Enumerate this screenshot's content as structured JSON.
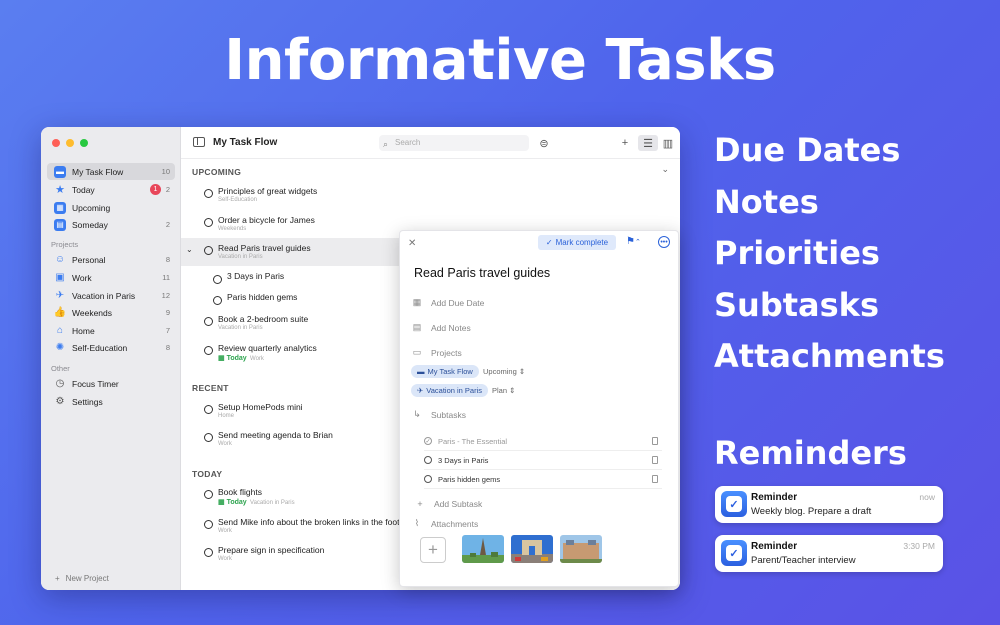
{
  "headline": "Informative Tasks",
  "features": [
    "Due Dates",
    "Notes",
    "Priorities",
    "Subtasks",
    "Attachments"
  ],
  "reminders": {
    "title": "Reminders",
    "items": [
      {
        "title": "Reminder",
        "body": "Weekly blog. Prepare a draft",
        "time": "now"
      },
      {
        "title": "Reminder",
        "body": "Parent/Teacher interview",
        "time": "3:30 PM"
      }
    ]
  },
  "sidebar": {
    "items": [
      {
        "label": "My Task Flow",
        "count": "10",
        "icon": "tray-icon",
        "color": "#3b7cf0"
      },
      {
        "label": "Today",
        "count": "2",
        "badge": "1",
        "icon": "star-icon",
        "color": "#3b7cf0"
      },
      {
        "label": "Upcoming",
        "count": "",
        "icon": "calendar-icon",
        "color": "#3b7cf0"
      },
      {
        "label": "Someday",
        "count": "2",
        "icon": "archive-icon",
        "color": "#3b7cf0"
      }
    ],
    "projects_label": "Projects",
    "projects": [
      {
        "label": "Personal",
        "count": "8",
        "icon": "person-icon"
      },
      {
        "label": "Work",
        "count": "11",
        "icon": "briefcase-icon"
      },
      {
        "label": "Vacation in Paris",
        "count": "12",
        "icon": "airplane-icon"
      },
      {
        "label": "Weekends",
        "count": "9",
        "icon": "thumbs-up-icon"
      },
      {
        "label": "Home",
        "count": "7",
        "icon": "house-icon"
      },
      {
        "label": "Self-Education",
        "count": "8",
        "icon": "lightbulb-icon"
      }
    ],
    "other_label": "Other",
    "other": [
      {
        "label": "Focus Timer",
        "icon": "timer-icon"
      },
      {
        "label": "Settings",
        "icon": "gear-icon"
      }
    ],
    "new_project": "New Project"
  },
  "toolbar": {
    "title": "My Task Flow",
    "search_placeholder": "Search"
  },
  "list": {
    "upcoming_label": "UPCOMING",
    "recent_label": "RECENT",
    "today_label": "TODAY",
    "upcoming": [
      {
        "title": "Principles of great widgets",
        "sub": "Self-Education"
      },
      {
        "title": "Order a bicycle for James",
        "sub": "Weekends"
      },
      {
        "title": "Read Paris travel guides",
        "sub": "Vacation in Paris"
      },
      {
        "title": "3 Days in Paris",
        "sub": ""
      },
      {
        "title": "Paris hidden gems",
        "sub": ""
      },
      {
        "title": "Book a 2-bedroom suite",
        "sub": "Vacation in Paris"
      },
      {
        "title": "Review quarterly analytics",
        "today": "Today",
        "sub": "Work"
      }
    ],
    "recent": [
      {
        "title": "Setup HomePods mini",
        "sub": "Home"
      },
      {
        "title": "Send meeting agenda to Brian",
        "sub": "Work"
      }
    ],
    "today": [
      {
        "title": "Book flights",
        "today": "Today",
        "sub": "Vacation in Paris"
      },
      {
        "title": "Send Mike info about the broken links in the foote",
        "sub": "Work"
      },
      {
        "title": "Prepare sign in specification",
        "sub": "Work"
      }
    ]
  },
  "detail": {
    "mark_complete": "Mark complete",
    "title": "Read Paris travel guides",
    "add_due_date": "Add Due Date",
    "add_notes": "Add Notes",
    "projects_label": "Projects",
    "chip1": "My Task Flow",
    "chip1_sel": "Upcoming",
    "chip2": "Vacation in Paris",
    "chip2_sel": "Plan",
    "subtasks_label": "Subtasks",
    "subtasks": [
      {
        "title": "Paris - The Essential",
        "done": true
      },
      {
        "title": "3 Days in Paris",
        "done": false
      },
      {
        "title": "Paris hidden gems",
        "done": false
      }
    ],
    "add_subtask": "Add Subtask",
    "attachments_label": "Attachments"
  }
}
